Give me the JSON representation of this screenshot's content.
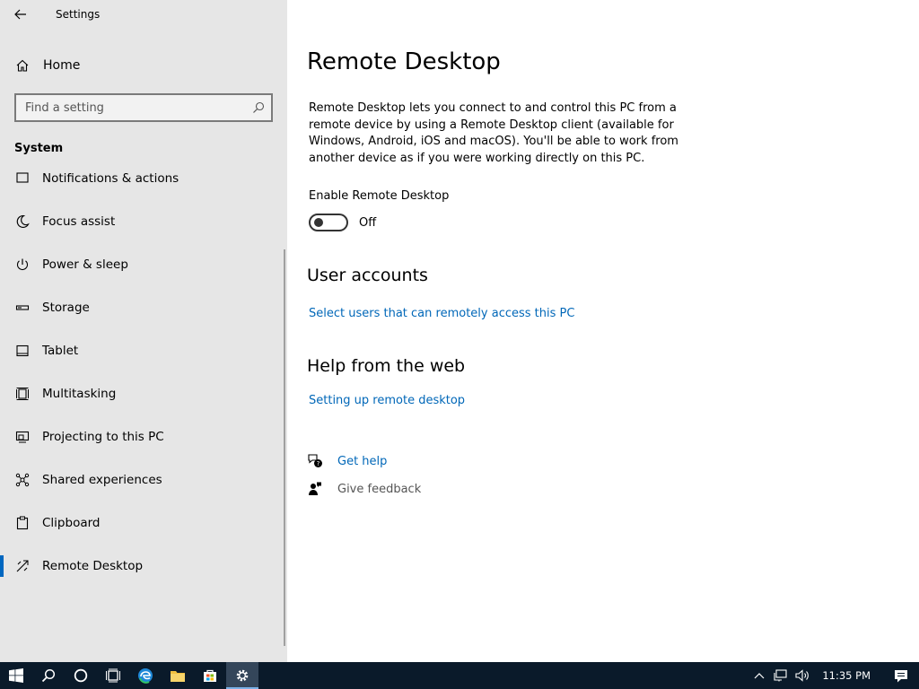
{
  "window": {
    "title": "Settings"
  },
  "nav": {
    "home_label": "Home",
    "search_placeholder": "Find a setting",
    "section_title": "System",
    "items": [
      {
        "label": "Notifications & actions",
        "icon": "notification-icon"
      },
      {
        "label": "Focus assist",
        "icon": "moon-icon"
      },
      {
        "label": "Power & sleep",
        "icon": "power-icon"
      },
      {
        "label": "Storage",
        "icon": "storage-icon"
      },
      {
        "label": "Tablet",
        "icon": "tablet-icon"
      },
      {
        "label": "Multitasking",
        "icon": "multitasking-icon"
      },
      {
        "label": "Projecting to this PC",
        "icon": "projector-icon"
      },
      {
        "label": "Shared experiences",
        "icon": "share-icon"
      },
      {
        "label": "Clipboard",
        "icon": "clipboard-icon"
      },
      {
        "label": "Remote Desktop",
        "icon": "remote-desktop-icon",
        "active": true
      }
    ]
  },
  "main": {
    "title": "Remote Desktop",
    "description": "Remote Desktop lets you connect to and control this PC from a remote device by using a Remote Desktop client (available for Windows, Android, iOS and macOS). You'll be able to work from another device as if you were working directly on this PC.",
    "toggle": {
      "label": "Enable Remote Desktop",
      "state": "Off"
    },
    "user_accounts": {
      "heading": "User accounts",
      "link": "Select users that can remotely access this PC"
    },
    "help": {
      "heading": "Help from the web",
      "link": "Setting up remote desktop"
    },
    "get_help": "Get help",
    "give_feedback": "Give feedback"
  },
  "taskbar": {
    "clock": "11:35 PM"
  },
  "colors": {
    "accent": "#0067c0",
    "link": "#0067b8",
    "nav_bg": "#e6e6e6",
    "taskbar_bg": "#0a1a2a"
  }
}
